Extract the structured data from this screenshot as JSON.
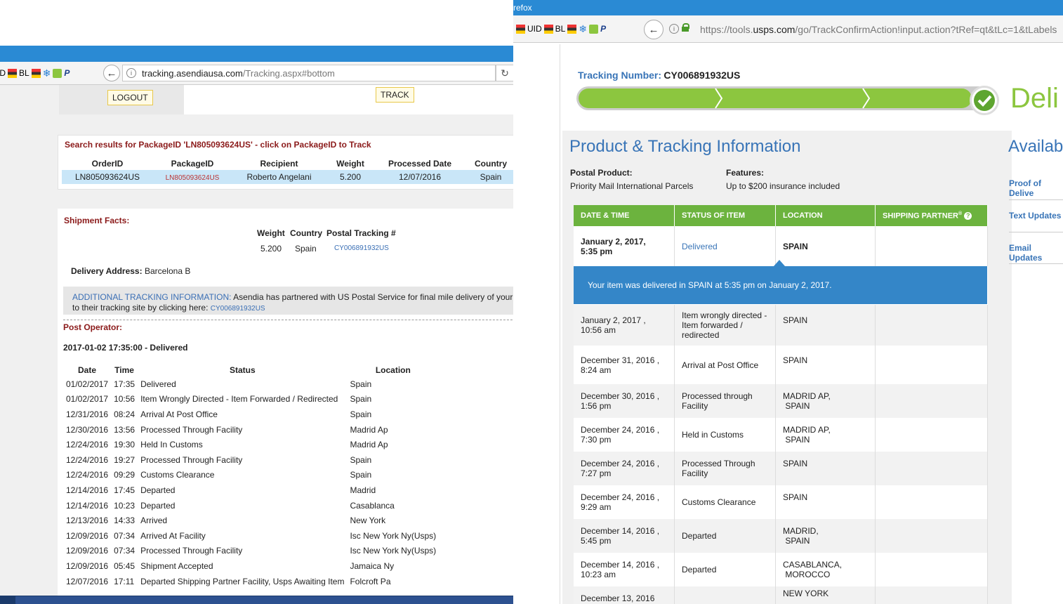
{
  "left": {
    "toolbar": {
      "bookmarks": [
        "UID",
        "BL"
      ],
      "url_host": "tracking.asendiausa.com",
      "url_path": "/Tracking.aspx#bottom"
    },
    "buttons": {
      "logout": "LOGOUT",
      "track": "TRACK"
    },
    "search_heading": "Search results for PackageID 'LN805093624US' - click on PackageID to Track",
    "results": {
      "headers": [
        "OrderID",
        "PackageID",
        "Recipient",
        "Weight",
        "Processed Date",
        "Country"
      ],
      "row": [
        "LN805093624US",
        "LN805093624US",
        "Roberto Angelani",
        "5.200",
        "12/07/2016",
        "Spain"
      ]
    },
    "shipment_facts": {
      "label": "Shipment Facts:",
      "headers": [
        "Weight",
        "Country",
        "Postal Tracking #"
      ],
      "values": [
        "5.200",
        "Spain",
        "CY006891932US"
      ],
      "delivery_label": "Delivery Address:",
      "delivery_value": "Barcelona B"
    },
    "additional": {
      "label": "ADDITIONAL TRACKING INFORMATION:",
      "text1": "Asendia has partnered with US Postal Service for final mile delivery of your parcel. Yo",
      "text2": "to their tracking site by clicking here:",
      "link": "CY006891932US"
    },
    "post_operator": {
      "label": "Post Operator:",
      "latest": "2017-01-02 17:35:00 - Delivered",
      "headers": [
        "Date",
        "Time",
        "Status",
        "Location"
      ],
      "rows": [
        [
          "01/02/2017",
          "17:35",
          "Delivered",
          "Spain"
        ],
        [
          "01/02/2017",
          "10:56",
          "Item Wrongly Directed - Item Forwarded / Redirected",
          "Spain"
        ],
        [
          "12/31/2016",
          "08:24",
          "Arrival At Post Office",
          "Spain"
        ],
        [
          "12/30/2016",
          "13:56",
          "Processed Through Facility",
          "Madrid Ap"
        ],
        [
          "12/24/2016",
          "19:30",
          "Held In Customs",
          "Madrid Ap"
        ],
        [
          "12/24/2016",
          "19:27",
          "Processed Through Facility",
          "Spain"
        ],
        [
          "12/24/2016",
          "09:29",
          "Customs Clearance",
          "Spain"
        ],
        [
          "12/14/2016",
          "17:45",
          "Departed",
          "Madrid"
        ],
        [
          "12/14/2016",
          "10:23",
          "Departed",
          "Casablanca"
        ],
        [
          "12/13/2016",
          "14:33",
          "Arrived",
          "New York"
        ],
        [
          "12/09/2016",
          "07:34",
          "Arrived At Facility",
          "Isc New York Ny(Usps)"
        ],
        [
          "12/09/2016",
          "07:34",
          "Processed Through Facility",
          "Isc New York Ny(Usps)"
        ],
        [
          "12/09/2016",
          "05:45",
          "Shipment Accepted",
          "Jamaica Ny"
        ],
        [
          "12/07/2016",
          "17:11",
          "Departed Shipping Partner Facility, Usps Awaiting Item",
          "Folcroft Pa"
        ]
      ]
    }
  },
  "right": {
    "window_title": "refox",
    "toolbar": {
      "bookmarks": [
        "UID",
        "BL"
      ],
      "url_prefix": "https://tools.",
      "url_host": "usps.com",
      "url_path": "/go/TrackConfirmAction!input.action?tRef=qt&tLc=1&tLabels"
    },
    "tracking_label": "Tracking Number:",
    "tracking_number": "CY006891932US",
    "status_word": "Deli",
    "section_title": "Product & Tracking Information",
    "available_title": "Availab",
    "postal_product_label": "Postal Product:",
    "postal_product_value": "Priority Mail International Parcels",
    "features_label": "Features:",
    "features_value": "Up to $200 insurance included",
    "side_links": [
      "Proof of Delive",
      "Text Updates",
      "Email Updates"
    ],
    "table_headers": [
      "DATE & TIME",
      "STATUS OF ITEM",
      "LOCATION",
      "SHIPPING PARTNER"
    ],
    "registered_mark": "®",
    "help_glyph": "?",
    "first_row": [
      "January 2, 2017,",
      "5:35 pm",
      "Delivered",
      "SPAIN"
    ],
    "banner": "Your item was delivered in SPAIN at 5:35 pm on January 2, 2017.",
    "rows": [
      {
        "d1": "January 2, 2017 ,",
        "d2": "10:56 am",
        "s": "Item wrongly directed - Item forwarded / redirected",
        "l1": "SPAIN",
        "l2": ""
      },
      {
        "d1": "December 31, 2016 ,",
        "d2": "8:24 am",
        "s": "Arrival at Post Office",
        "l1": "SPAIN",
        "l2": ""
      },
      {
        "d1": "December 30, 2016 ,",
        "d2": "1:56 pm",
        "s": "Processed through Facility",
        "l1": "MADRID AP,",
        "l2": "SPAIN"
      },
      {
        "d1": "December 24, 2016 ,",
        "d2": "7:30 pm",
        "s": "Held in Customs",
        "l1": "MADRID AP,",
        "l2": "SPAIN"
      },
      {
        "d1": "December 24, 2016 ,",
        "d2": "7:27 pm",
        "s": "Processed Through Facility",
        "l1": "SPAIN",
        "l2": ""
      },
      {
        "d1": "December 24, 2016 ,",
        "d2": "9:29 am",
        "s": "Customs Clearance",
        "l1": "SPAIN",
        "l2": ""
      },
      {
        "d1": "December 14, 2016 ,",
        "d2": "5:45 pm",
        "s": "Departed",
        "l1": "MADRID,",
        "l2": "SPAIN"
      },
      {
        "d1": "December 14, 2016 ,",
        "d2": "10:23 am",
        "s": "Departed",
        "l1": "CASABLANCA,",
        "l2": "MOROCCO"
      },
      {
        "d1": "December 13, 2016",
        "d2": "",
        "s": "",
        "l1": "NEW YORK",
        "l2": ""
      }
    ]
  },
  "colors": {
    "usps_green": "#8cc63f",
    "usps_blue": "#3874b7",
    "firefox_blue": "#2a8ad4",
    "asendia_red": "#8b1a1a"
  }
}
